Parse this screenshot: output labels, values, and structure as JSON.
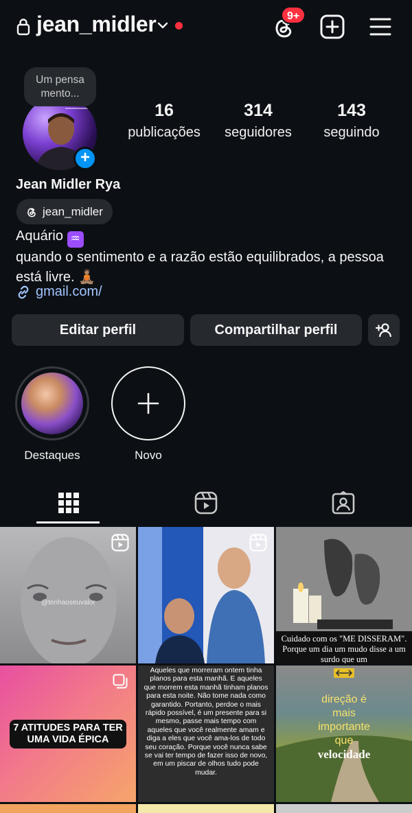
{
  "header": {
    "username": "jean_midler",
    "notification_badge": "9+",
    "accent_red": "#ff3040"
  },
  "profile": {
    "note": "Um pensa mento...",
    "display_name": "Jean Midler Rya",
    "threads_handle": "jean_midler",
    "bio_line1": "Aquário",
    "bio_emoji": "♒",
    "bio_line2": "quando o sentimento e a razão estão equilibrados, a pessoa está livre. 🧘🏽",
    "link_text": "gmail.com/",
    "stats": [
      {
        "value": "16",
        "label": "publicações"
      },
      {
        "value": "314",
        "label": "seguidores"
      },
      {
        "value": "143",
        "label": "seguindo"
      }
    ]
  },
  "actions": {
    "edit_label": "Editar perfil",
    "share_label": "Compartilhar perfil"
  },
  "highlights": [
    {
      "label": "Destaques"
    },
    {
      "label": "Novo"
    }
  ],
  "tabs": [
    "grid-icon",
    "reels-icon",
    "tagged-icon"
  ],
  "posts": {
    "p1_watermark": "@tenhaoseuvalor",
    "p3_caption": "Cuidado com os \"ME DISSERAM\". Porque um dia um mudo disse a um surdo que um",
    "p4_caption": "7 ATITUDES PARA TER UMA VIDA ÉPICA",
    "p5_caption": "Aqueles que morreram ontem tinha planos para esta manhã. E aqueles que morrem esta manhã tinham planos para esta noite. Não tome nada como garantido. Portanto, perdoe o mais rápido possível, é um presente para si mesmo, passe mais tempo com aqueles que você realmente amam e diga a eles que você ama-los de todo seu coração. Porque você nunca sabe se vai ter tempo de fazer isso de novo, em um piscar de olhos tudo pode mudar.",
    "p6_line1": "direção é",
    "p6_line2": "mais",
    "p6_line3": "importante",
    "p6_line4": "que",
    "p6_line5": "velocidade"
  }
}
